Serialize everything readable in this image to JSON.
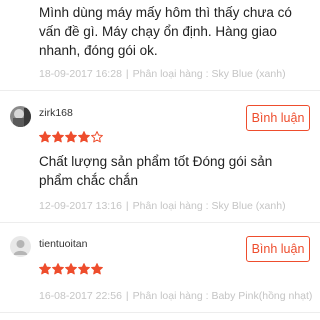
{
  "reviews": [
    {
      "text": "Mình dùng máy mấy hôm thì thấy chưa có vấn đề gì. Máy chạy ổn định. Hàng giao nhanh, đóng gói ok.",
      "datetime": "18-09-2017 16:28",
      "variation": "Phân loại hàng : Sky Blue (xanh)"
    },
    {
      "username": "zirk168",
      "rating": 4,
      "max_rating": 5,
      "comment_button": "Bình luận",
      "text": "Chất lượng sản phẩm tốt Đóng gói sản phẩm chắc chắn",
      "datetime": "12-09-2017 13:16",
      "variation": "Phân loại hàng : Sky Blue (xanh)"
    },
    {
      "username": "tientuoitan",
      "rating": 5,
      "max_rating": 5,
      "comment_button": "Bình luận",
      "datetime": "16-08-2017 22:56",
      "variation": "Phân loại hàng : Baby Pink(hồng nhạt)"
    }
  ],
  "colors": {
    "accent": "#ee4d2d",
    "muted": "#c4c4c4",
    "divider": "#ededed"
  },
  "icons": {
    "star_filled": "star-filled-icon",
    "star_empty": "star-empty-icon",
    "avatar_default": "default-avatar-icon"
  }
}
